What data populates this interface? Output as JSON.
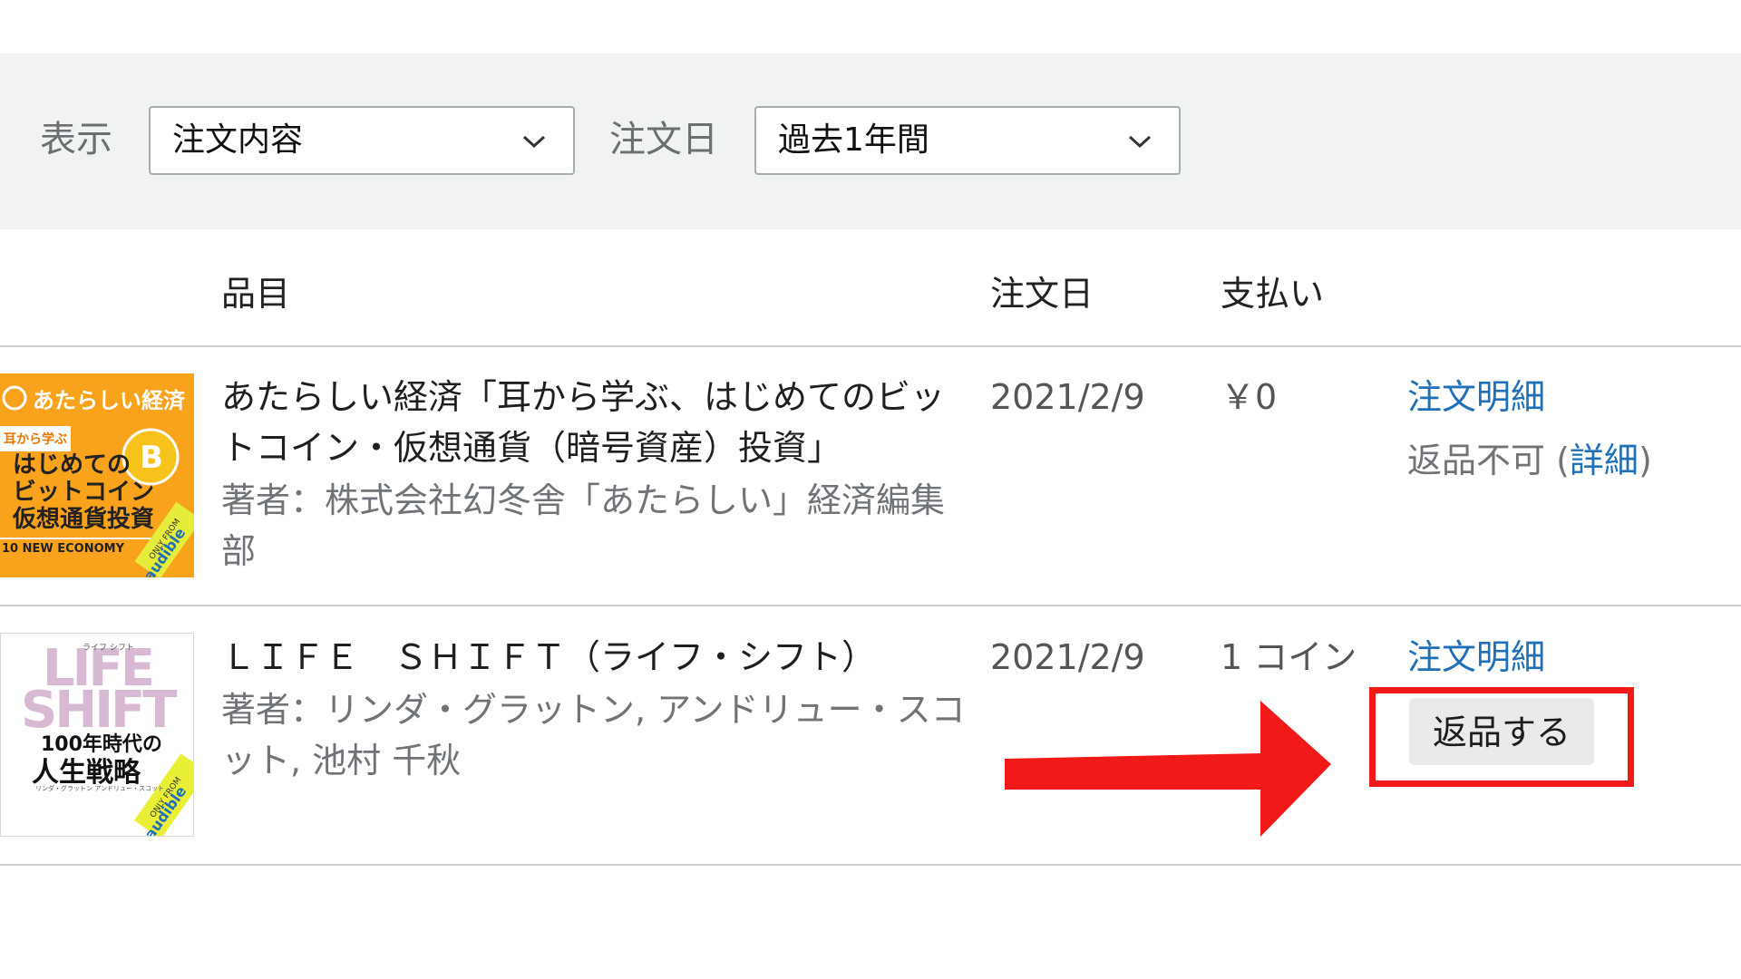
{
  "filters": {
    "display_label": "表示",
    "display_value": "注文内容",
    "date_label": "注文日",
    "date_value": "過去1年間"
  },
  "table_header": {
    "item": "品目",
    "order_date": "注文日",
    "payment": "支払い"
  },
  "orders": [
    {
      "title": "あたらしい経済「耳から学ぶ、はじめてのビットコイン・仮想通貨（暗号資産）投資」",
      "author": "著者：株式会社幻冬舎「あたらしい」経済編集部",
      "date": "2021/2/9",
      "payment": "￥0",
      "details_link": "注文明細",
      "return_status": "返品不可",
      "return_paren_open": " (",
      "return_detail_link": "詳細",
      "return_paren_close": ")",
      "cover": {
        "brand": "あたらしい経済",
        "tag": "耳から学ぶ",
        "line1": "はじめての",
        "line2": "ビットコイン",
        "line3": "仮想通貨投資",
        "footer": "10 NEW ECONOMY",
        "badge_top": "ONLY FROM",
        "badge_bottom": "audible",
        "colors": {
          "bg": "#f9a21b",
          "accent": "#ffffff"
        }
      }
    },
    {
      "title": "ＬＩＦＥ　ＳＨＩＦＴ（ライフ・シフト）",
      "author": "著者：リンダ・グラットン, アンドリュー・スコット, 池村 千秋",
      "date": "2021/2/9",
      "payment": "1 コイン",
      "details_link": "注文明細",
      "return_button": "返品する",
      "cover": {
        "big1": "LIFE",
        "big2": "SHIFT",
        "ruby": "ライフ シフト",
        "sub1": "100年時代の",
        "sub2": "人生戦略",
        "authors": "リンダ・グラットン アンドリュー・スコット",
        "badge_top": "ONLY FROM",
        "badge_bottom": "audible",
        "colors": {
          "bg": "#ffffff",
          "accent": "#d7b9d3",
          "badge": "#e8ef35"
        }
      }
    }
  ],
  "annotation": {
    "arrow_color": "#f21919",
    "box_color": "#f21919"
  }
}
